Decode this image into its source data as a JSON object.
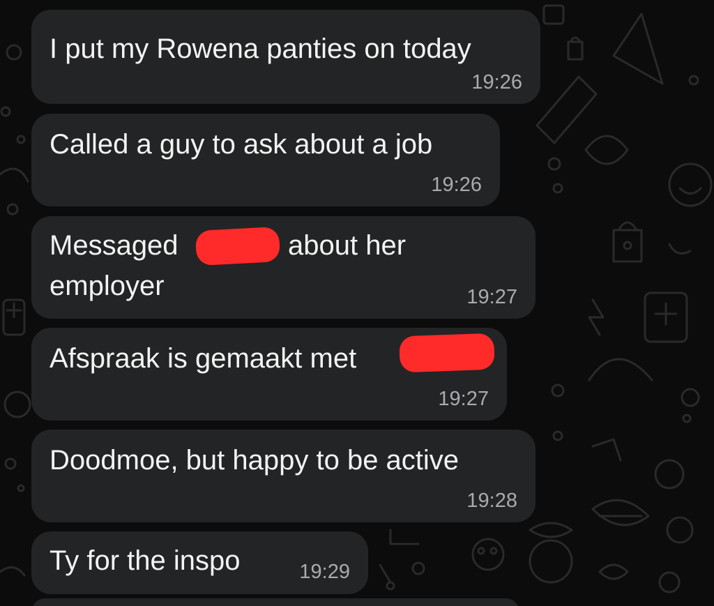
{
  "messages": [
    {
      "text": "I put my Rowena panties on today",
      "time": "19:26"
    },
    {
      "text": "Called a guy to ask about a job",
      "time": "19:26"
    },
    {
      "text_line1_start": "Messaged",
      "text_line1_end": "about her",
      "text_line2": "employer",
      "time": "19:27"
    },
    {
      "text_start": "Afspraak is gemaakt met",
      "time": "19:27"
    },
    {
      "text": "Doodmoe, but happy to be active",
      "time": "19:28"
    },
    {
      "text": "Ty for the inspo",
      "time": "19:29"
    }
  ],
  "colors": {
    "background": "#0c0c0c",
    "bubble": "#232425",
    "text": "#f3f3f3",
    "timestamp": "#a9acaf",
    "redaction": "#ff2a2a"
  }
}
